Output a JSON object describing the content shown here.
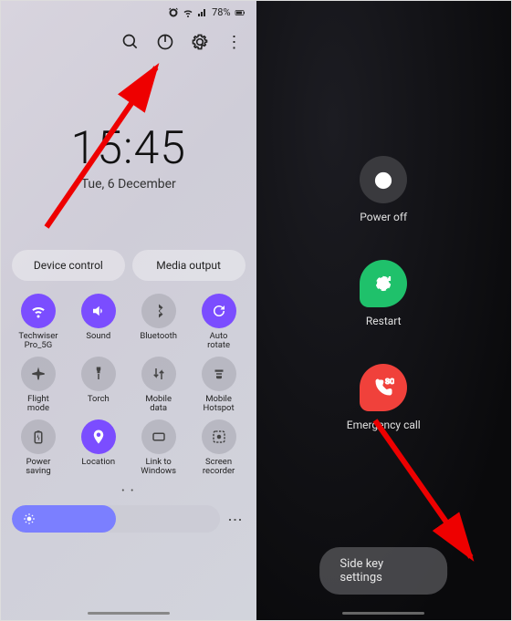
{
  "left": {
    "status": {
      "battery": "78%"
    },
    "clock": {
      "time": "15:45",
      "date": "Tue, 6 December"
    },
    "device_buttons": {
      "control": "Device control",
      "media": "Media output"
    },
    "tiles": [
      {
        "label": "Techwiser Pro_5G",
        "active": true,
        "icon": "wifi"
      },
      {
        "label": "Sound",
        "active": true,
        "icon": "sound"
      },
      {
        "label": "Bluetooth",
        "active": false,
        "icon": "bluetooth"
      },
      {
        "label": "Auto\nrotate",
        "active": true,
        "icon": "rotate"
      },
      {
        "label": "Flight\nmode",
        "active": false,
        "icon": "airplane"
      },
      {
        "label": "Torch",
        "active": false,
        "icon": "torch"
      },
      {
        "label": "Mobile\ndata",
        "active": false,
        "icon": "data"
      },
      {
        "label": "Mobile\nHotspot",
        "active": false,
        "icon": "hotspot"
      },
      {
        "label": "Power\nsaving",
        "active": false,
        "icon": "battery"
      },
      {
        "label": "Location",
        "active": true,
        "icon": "location"
      },
      {
        "label": "Link to\nWindows",
        "active": false,
        "icon": "link"
      },
      {
        "label": "Screen\nrecorder",
        "active": false,
        "icon": "record"
      }
    ]
  },
  "right": {
    "power_off": "Power off",
    "restart": "Restart",
    "emergency": "Emergency call",
    "side_key": "Side key settings"
  }
}
